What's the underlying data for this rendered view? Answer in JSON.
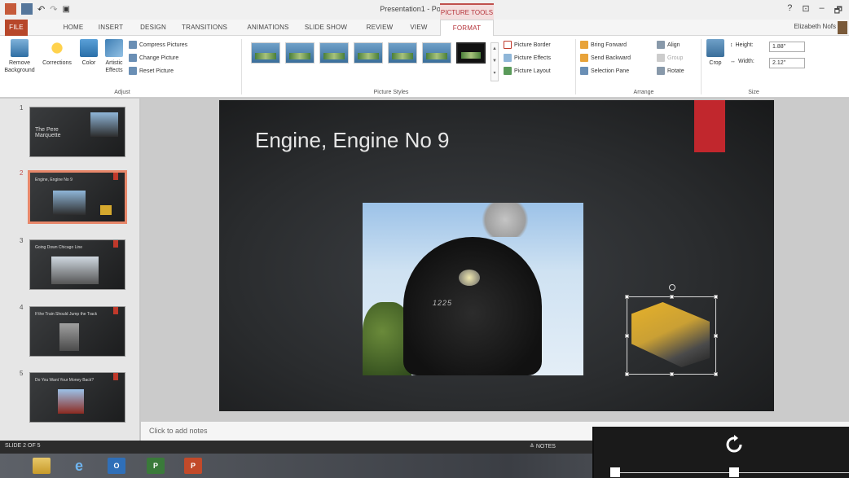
{
  "window": {
    "title": "Presentation1 - PowerPoint",
    "contextual_tab_header": "PICTURE TOOLS",
    "controls": [
      "?",
      "⊡",
      "–",
      "🗗"
    ]
  },
  "tabs": [
    "FILE",
    "HOME",
    "INSERT",
    "DESIGN",
    "TRANSITIONS",
    "ANIMATIONS",
    "SLIDE SHOW",
    "REVIEW",
    "VIEW",
    "FORMAT"
  ],
  "active_tab": "FORMAT",
  "user": "Elizabeth Nofs",
  "ribbon": {
    "adjust": {
      "remove_background": "Remove Background",
      "corrections": "Corrections",
      "color": "Color",
      "artistic_effects": "Artistic Effects",
      "compress_pictures": "Compress Pictures",
      "change_picture": "Change Picture",
      "reset_picture": "Reset Picture",
      "label": "Adjust"
    },
    "picture_styles": {
      "picture_border": "Picture Border",
      "picture_effects": "Picture Effects",
      "picture_layout": "Picture Layout",
      "label": "Picture Styles"
    },
    "arrange": {
      "bring_forward": "Bring Forward",
      "send_backward": "Send Backward",
      "selection_pane": "Selection Pane",
      "align": "Align",
      "group": "Group",
      "rotate": "Rotate",
      "label": "Arrange"
    },
    "size": {
      "crop": "Crop",
      "height_label": "Height:",
      "height_value": "1.88\"",
      "width_label": "Width:",
      "width_value": "2.12\"",
      "label": "Size"
    }
  },
  "slides": [
    {
      "num": "1",
      "title": "The Pere Marquette"
    },
    {
      "num": "2",
      "title": "Engine, Engine No 9"
    },
    {
      "num": "3",
      "title": "Going Down Chicago Line"
    },
    {
      "num": "4",
      "title": "If the Train Should Jump the Track"
    },
    {
      "num": "5",
      "title": "Do You Want Your Money Back?"
    }
  ],
  "current_slide": {
    "title": "Engine, Engine No 9",
    "locomotive_number": "1225"
  },
  "notes_placeholder": "Click to add notes",
  "status": {
    "slide_indicator": "SLIDE 2 OF 5",
    "notes_button": "NOTES"
  },
  "taskbar": [
    "file-explorer-icon",
    "internet-explorer-icon",
    "outlook-icon",
    "project-icon",
    "powerpoint-icon"
  ]
}
